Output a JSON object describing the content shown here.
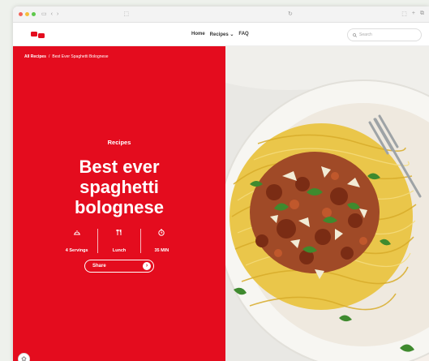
{
  "colors": {
    "brand_red": "#e40c1e",
    "window_bg": "#eef1ec"
  },
  "browser": {
    "traffic_lights": [
      "#f2635a",
      "#f6be3a",
      "#5ec94c"
    ],
    "icons": [
      "sidebar-icon",
      "back-icon",
      "forward-icon",
      "share-icon",
      "reload-icon",
      "tab-icon",
      "new-tab-icon"
    ]
  },
  "nav": {
    "links": [
      "Home",
      "Recipes",
      "FAQ"
    ],
    "recipes_chevron": "⌄",
    "search_placeholder": "Search"
  },
  "hero": {
    "breadcrumb_root": "All Recipes",
    "breadcrumb_sep": "/",
    "breadcrumb_current": "Best Ever Spaghetti Bolognese",
    "kicker": "Recipes",
    "title_lines": [
      "Best ever",
      "spaghetti",
      "bolognese"
    ],
    "meta": [
      {
        "icon": "servings-icon",
        "text": "4 Servings"
      },
      {
        "icon": "meal-icon",
        "text": "Lunch"
      },
      {
        "icon": "timer-icon",
        "text": "35 MIN"
      }
    ],
    "share_label": "Share"
  }
}
